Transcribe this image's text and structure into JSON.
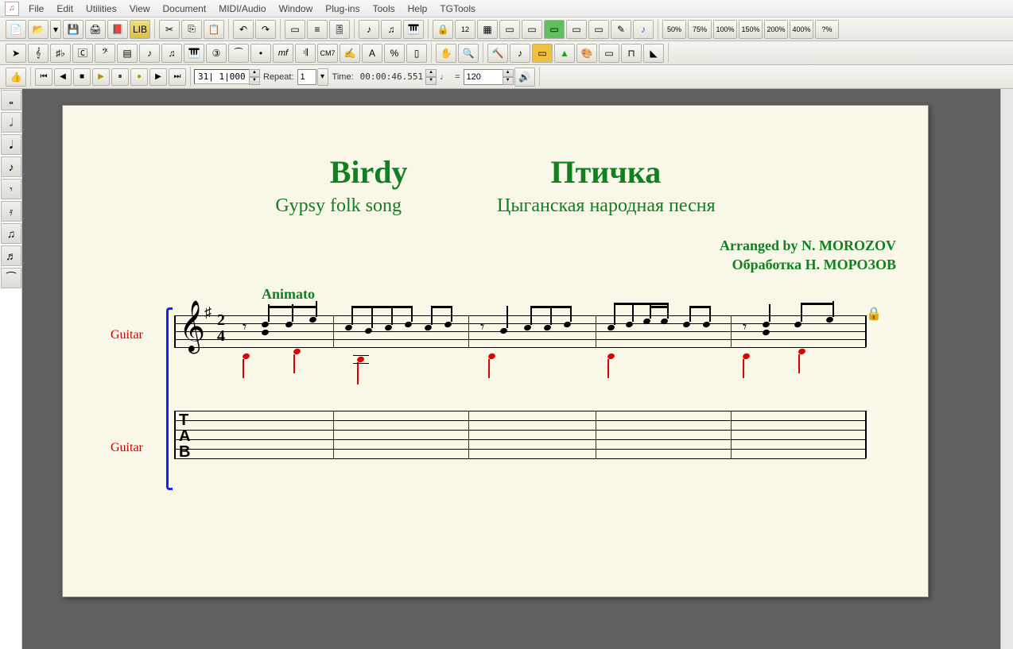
{
  "menu": {
    "items": [
      "File",
      "Edit",
      "Utilities",
      "View",
      "Document",
      "MIDI/Audio",
      "Window",
      "Plug-ins",
      "Tools",
      "Help",
      "TGTools"
    ]
  },
  "transport": {
    "counter": "31| 1|0000",
    "repeat_label": "Repeat:",
    "repeat_value": "1",
    "time_label": "Time:",
    "time_value": "00:00:46.551",
    "tempo_eq": "=",
    "tempo_value": "120"
  },
  "zoom": {
    "levels": [
      "50%",
      "75%",
      "100%",
      "150%",
      "200%",
      "400%",
      "?%"
    ]
  },
  "score": {
    "title_left": "Birdy",
    "title_right": "Птичка",
    "subtitle_left": "Gypsy folk song",
    "subtitle_right": "Цыганская народная песня",
    "arranger_line1": "Arranged by N. MOROZOV",
    "arranger_line2": "Обработка Н. МОРОЗОВ",
    "tempo_mark": "Animato",
    "instrument": "Guitar",
    "time_sig_top": "2",
    "time_sig_bot": "4",
    "tab_letters": [
      "T",
      "A",
      "B"
    ]
  },
  "palette": {
    "icons": [
      "whole-note-icon",
      "half-note-icon",
      "quarter-note-icon",
      "eighth-note-icon",
      "eighth-rest-icon",
      "sixteenth-rest-icon",
      "beam-icon",
      "tuplet-icon",
      "tie-icon"
    ]
  }
}
